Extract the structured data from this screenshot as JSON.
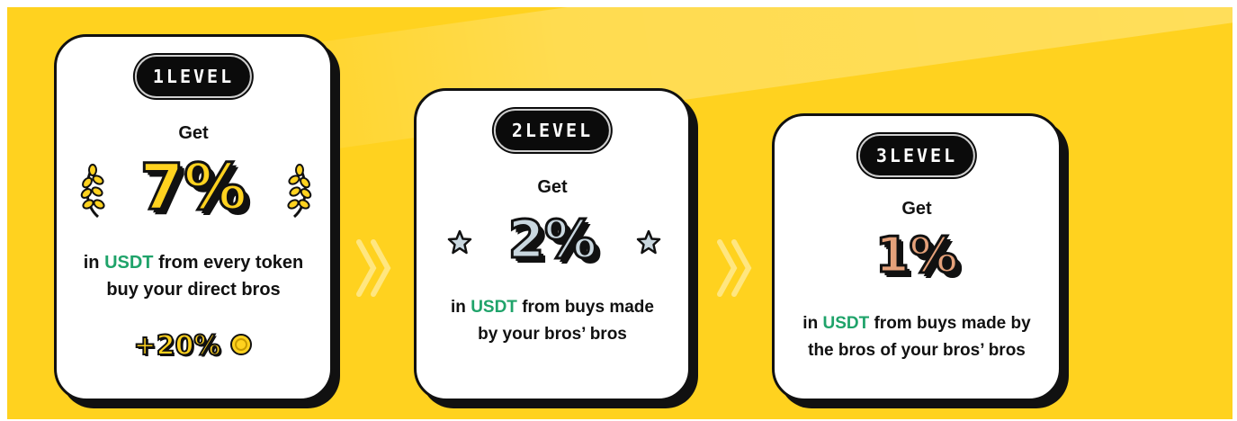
{
  "levels": [
    {
      "badge": "1LEVEL",
      "get": "Get",
      "percent": "7%",
      "desc_prefix": "in ",
      "currency": "USDT",
      "desc_line1_rest": " from every token",
      "desc_line2": "buy your direct bros",
      "bonus": "+20%",
      "bonus_icon": "coin-icon",
      "decor_icon": "laurel-icon"
    },
    {
      "badge": "2LEVEL",
      "get": "Get",
      "percent": "2%",
      "desc_prefix": "in ",
      "currency": "USDT",
      "desc_line1_rest": " from buys made",
      "desc_line2": "by your bros’ bros",
      "decor_icon": "star-icon"
    },
    {
      "badge": "3LEVEL",
      "get": "Get",
      "percent": "1%",
      "desc_prefix": "in ",
      "currency": "USDT",
      "desc_line1_rest": " from buys made by",
      "desc_line2": "the bros of your bros’ bros"
    }
  ],
  "colors": {
    "background": "#ffd21f",
    "accent_green": "#1fa36a",
    "gold": "#ffd21f",
    "silver": "#c9d7df",
    "bronze": "#e5a17a"
  },
  "separator_icon": "double-chevron-right-icon"
}
